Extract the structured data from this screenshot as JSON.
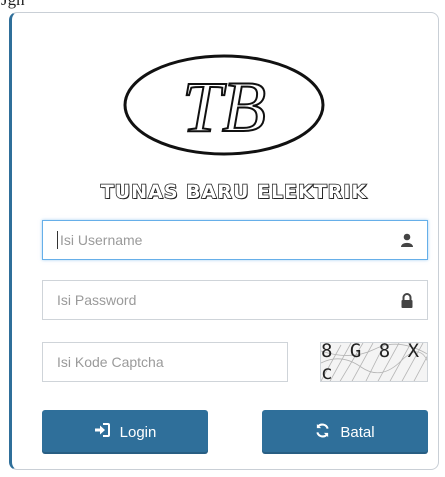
{
  "top_fragment": "Jgn",
  "brand": {
    "name": "TUNAS BARU ELEKTRIK",
    "monogram": "TB"
  },
  "form": {
    "username": {
      "placeholder": "Isi Username",
      "icon": "user-icon"
    },
    "password": {
      "placeholder": "Isi Password",
      "icon": "lock-icon"
    },
    "captcha_input": {
      "placeholder": "Isi Kode Captcha"
    },
    "captcha_image": {
      "code": "8 G 8 X c"
    }
  },
  "buttons": {
    "login": {
      "label": "Login",
      "icon": "sign-in-icon"
    },
    "cancel": {
      "label": "Batal",
      "icon": "refresh-icon"
    }
  },
  "colors": {
    "accent": "#2f6f9a",
    "focus": "#66afe9"
  }
}
